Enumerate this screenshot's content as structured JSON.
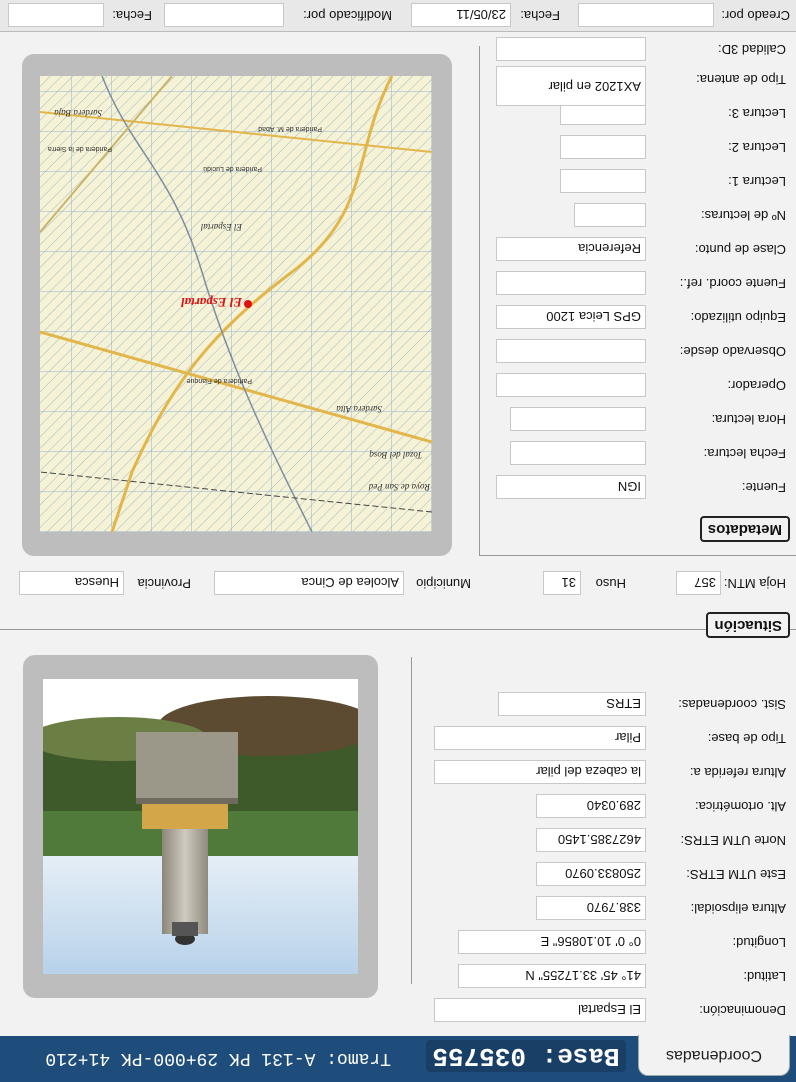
{
  "header": {
    "tab_label": "Coordenadas",
    "base_label": "Base: 035755",
    "tramo_label": "Tramo:  A-131 PK 29+000-PK 41+210"
  },
  "coordenadas": {
    "denominacion": {
      "label": "Denominación:",
      "value": "El Espartal"
    },
    "latitud": {
      "label": "Latitud:",
      "value": "41° 45' 33.17255\" N"
    },
    "longitud": {
      "label": "Longitud:",
      "value": "0° 0' 10.10856\" E"
    },
    "altura_elipsoidal": {
      "label": "Altura elipsoidal:",
      "value": "338.7970"
    },
    "este_utm": {
      "label": "Este UTM ETRS:",
      "value": "250833.0970"
    },
    "norte_utm": {
      "label": "Norte UTM ETRS:",
      "value": "4627385.1450"
    },
    "alt_ortometrica": {
      "label": "Alt. ortométrica:",
      "value": "289.0340"
    },
    "altura_referida": {
      "label": "Altura referida a:",
      "value": "la cabeza del pilar"
    },
    "tipo_base": {
      "label": "Tipo de base:",
      "value": "Pilar"
    },
    "sist_coordenadas": {
      "label": "Sist. coordenadas:",
      "value": "ETRS"
    }
  },
  "situacion": {
    "title": "Situación",
    "hoja_mtn": {
      "label": "Hoja MTN:",
      "value": "357"
    },
    "huso": {
      "label": "Huso",
      "value": "31"
    },
    "municipio": {
      "label": "Municipio",
      "value": "Alcolea de Cinca"
    },
    "provincia": {
      "label": "Provincia",
      "value": "Huesca"
    }
  },
  "metadatos": {
    "title": "Metadatos",
    "fuente": {
      "label": "Fuente:",
      "value": "IGN"
    },
    "fecha_lectura": {
      "label": "Fecha lectura:",
      "value": ""
    },
    "hora_lectura": {
      "label": "Hora lectura:",
      "value": ""
    },
    "operador": {
      "label": "Operador:",
      "value": ""
    },
    "observado_desde": {
      "label": "Observado desde:",
      "value": ""
    },
    "equipo": {
      "label": "Equipo utilizado:",
      "value": "GPS Leica 1200"
    },
    "fuente_coord": {
      "label": "Fuente coord. ref.:",
      "value": ""
    },
    "clase_punto": {
      "label": "Clase de punto:",
      "value": "Referencia"
    },
    "n_lecturas": {
      "label": "Nº de lecturas:",
      "value": ""
    },
    "lectura1": {
      "label": "Lectura 1:",
      "value": ""
    },
    "lectura2": {
      "label": "Lectura 2:",
      "value": ""
    },
    "lectura3": {
      "label": "Lectura 3:",
      "value": ""
    },
    "tipo_antena": {
      "label": "Tipo de antena:",
      "value": "AX1202 en pilar"
    },
    "calidad_3d": {
      "label": "Calidad 3D:",
      "value": ""
    }
  },
  "map": {
    "place_label": "El Espartal",
    "labels": [
      "Sardera Alta",
      "Partidera de Fianque",
      "Paridera de M. Abad",
      "Paridera de la Sierra",
      "Sardera Baja",
      "Tozal del Bosq",
      "Roya de San Ped",
      "Paridera de Lucidú",
      "El Espartal"
    ]
  },
  "footer": {
    "creado_label": "Creado por:",
    "creado_value": "",
    "fecha1_label": "Fecha:",
    "fecha1_value": "23/05/11",
    "modificado_label": "Modificado por:",
    "modificado_value": "",
    "fecha2_label": "Fecha:",
    "fecha2_value": ""
  },
  "colors": {
    "header": "#1f4d7b",
    "panel": "#f2f2f2",
    "frame": "#bdbdbd"
  }
}
